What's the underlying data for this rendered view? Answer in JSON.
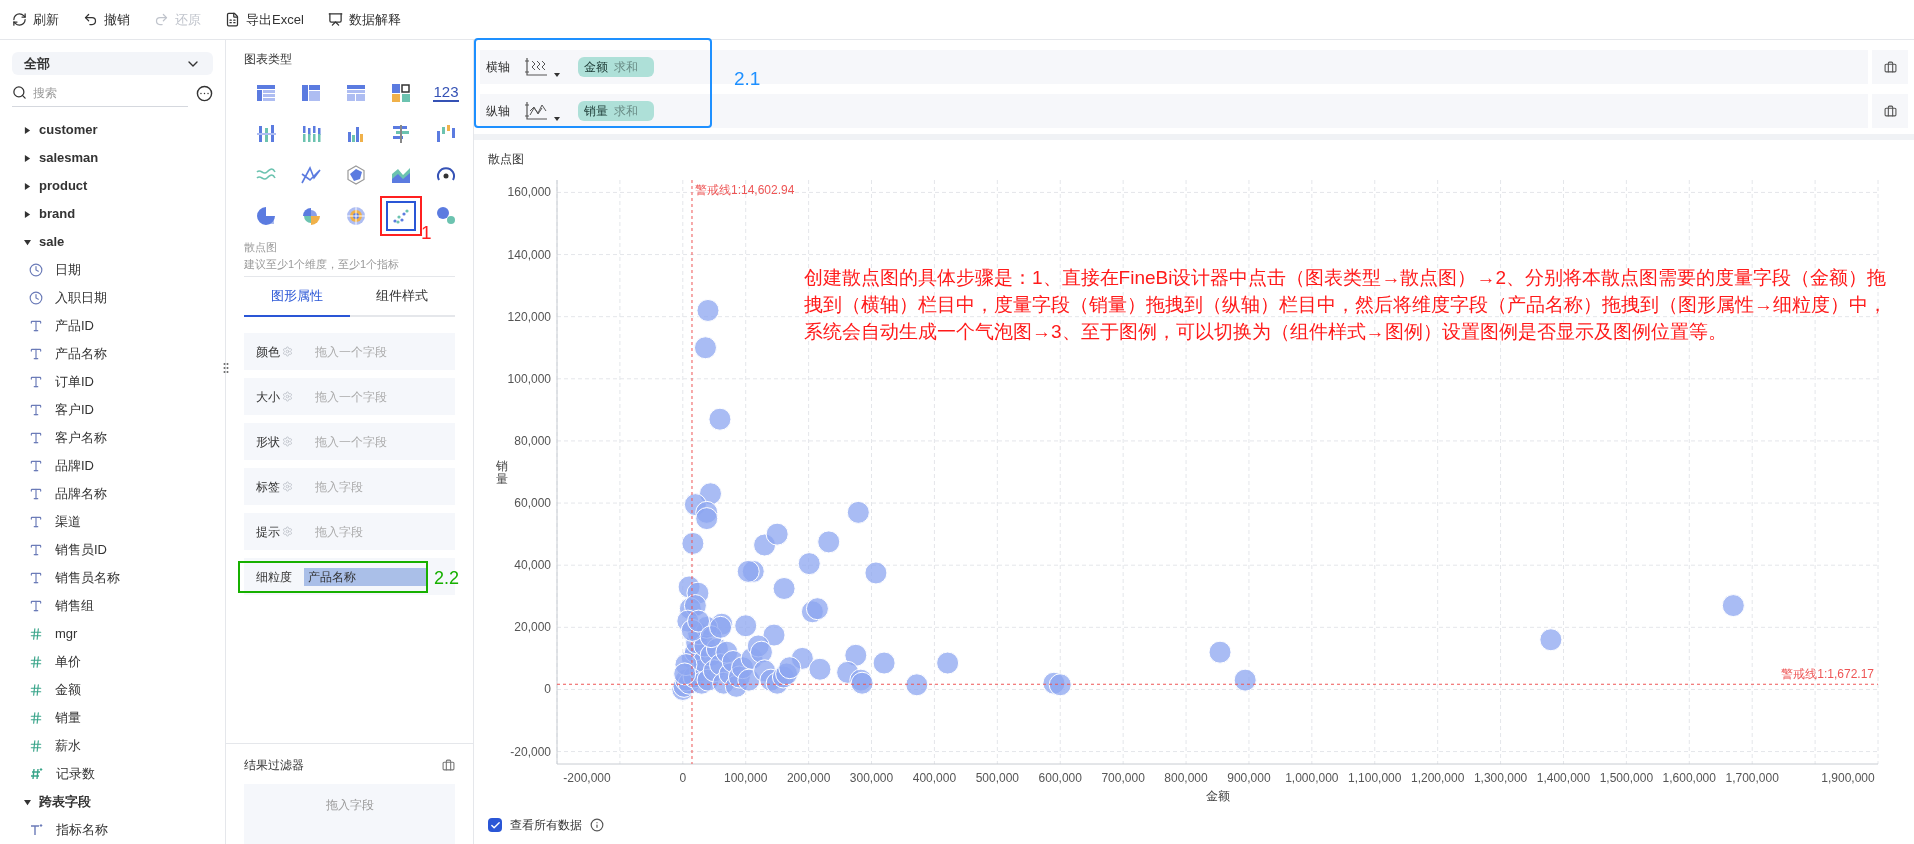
{
  "toolbar": [
    {
      "label": "刷新",
      "kind": "refresh",
      "disabled": false
    },
    {
      "label": "撤销",
      "kind": "undo",
      "disabled": false
    },
    {
      "label": "还原",
      "kind": "redo",
      "disabled": true
    },
    {
      "label": "导出Excel",
      "kind": "excel",
      "disabled": false
    },
    {
      "label": "数据解释",
      "kind": "explain",
      "disabled": false
    }
  ],
  "sidebar": {
    "dropdown": "全部",
    "search": {
      "placeholder": "搜索"
    },
    "fields": [
      {
        "label": "customer",
        "expanded": false
      },
      {
        "label": "salesman",
        "expanded": false
      },
      {
        "label": "product",
        "expanded": false
      },
      {
        "label": "brand",
        "expanded": false
      },
      {
        "label": "sale",
        "expanded": true,
        "children": [
          {
            "label": "日期",
            "kind": "date"
          },
          {
            "label": "入职日期",
            "kind": "date"
          },
          {
            "label": "产品ID",
            "kind": "text"
          },
          {
            "label": "产品名称",
            "kind": "text"
          },
          {
            "label": "订单ID",
            "kind": "text"
          },
          {
            "label": "客户ID",
            "kind": "text"
          },
          {
            "label": "客户名称",
            "kind": "text"
          },
          {
            "label": "品牌ID",
            "kind": "text"
          },
          {
            "label": "品牌名称",
            "kind": "text"
          },
          {
            "label": "渠道",
            "kind": "text"
          },
          {
            "label": "销售员ID",
            "kind": "text"
          },
          {
            "label": "销售员名称",
            "kind": "text"
          },
          {
            "label": "销售组",
            "kind": "text"
          },
          {
            "label": "mgr",
            "kind": "number"
          },
          {
            "label": "单价",
            "kind": "number"
          },
          {
            "label": "金额",
            "kind": "number"
          },
          {
            "label": "销量",
            "kind": "number"
          },
          {
            "label": "薪水",
            "kind": "number"
          },
          {
            "label": "记录数",
            "kind": "calc-number"
          }
        ]
      },
      {
        "label": "跨表字段",
        "expanded": true,
        "children": [
          {
            "label": "指标名称",
            "kind": "calc-text"
          }
        ]
      }
    ]
  },
  "chart_types_panel": {
    "title": "图表类型",
    "marker_label": "1",
    "types": [
      {
        "kind": "table",
        "selected": false
      },
      {
        "kind": "cross-table",
        "selected": false
      },
      {
        "kind": "detail-table",
        "selected": false
      },
      {
        "kind": "blocks",
        "selected": false
      },
      {
        "kind": "number",
        "label": "123",
        "selected": false
      },
      {
        "kind": "dot-bars",
        "selected": false
      },
      {
        "kind": "stacked-bars",
        "selected": false
      },
      {
        "kind": "bars",
        "selected": false
      },
      {
        "kind": "hbars",
        "selected": false
      },
      {
        "kind": "waterfall",
        "selected": false
      },
      {
        "kind": "waves",
        "selected": false
      },
      {
        "kind": "lines",
        "selected": false
      },
      {
        "kind": "radar",
        "selected": false
      },
      {
        "kind": "area",
        "selected": false
      },
      {
        "kind": "gauge",
        "selected": false
      },
      {
        "kind": "pie",
        "selected": false
      },
      {
        "kind": "rose",
        "selected": false
      },
      {
        "kind": "polar",
        "selected": false
      },
      {
        "kind": "scatter",
        "selected": true
      },
      {
        "kind": "bubble",
        "selected": false
      }
    ],
    "hint_title": "散点图",
    "hint": "建议至少1个维度，至少1个指标"
  },
  "property_tabs": [
    {
      "label": "图形属性",
      "selected": true
    },
    {
      "label": "组件样式",
      "selected": false
    }
  ],
  "properties": [
    {
      "label": "颜色",
      "kind": "drop",
      "placeholder": "拖入一个字段"
    },
    {
      "label": "大小",
      "kind": "drop",
      "placeholder": "拖入一个字段"
    },
    {
      "label": "形状",
      "kind": "drop",
      "placeholder": "拖入一个字段"
    },
    {
      "label": "标签",
      "kind": "drop",
      "placeholder": "拖入字段"
    },
    {
      "label": "提示",
      "kind": "drop",
      "placeholder": "拖入字段"
    },
    {
      "label": "细粒度",
      "kind": "granularity",
      "value": "产品名称",
      "marker_label": "2.2"
    }
  ],
  "result_filter": {
    "title": "结果过滤器",
    "placeholder": "拖入字段"
  },
  "axes": {
    "marker_label": "2.1",
    "rows": [
      {
        "label": "横轴",
        "kind": "x",
        "field": "金额",
        "aggregation": "求和"
      },
      {
        "label": "纵轴",
        "kind": "y",
        "field": "销量",
        "aggregation": "求和"
      }
    ]
  },
  "chart": {
    "title": "散点图",
    "note": "创建散点图的具体步骤是：1、直接在FineBi设计器中点击（图表类型→散点图）→2、分别将本散点图需要的度量字段（金额）拖拽到（横轴）栏目中，度量字段（销量）拖拽到（纵轴）栏目中，然后将维度字段（产品名称）拖拽到（图形属性→细粒度）中，系统会自动生成一个气泡图→3、至于图例，可以切换为（组件样式→图例）设置图例是否显示及图例位置等。",
    "show_all": {
      "label": "查看所有数据",
      "checked": true
    },
    "chart_data": {
      "type": "scatter",
      "grid": true,
      "xlabel": "金额",
      "ylabel": "销量",
      "xlim": [
        -200000,
        1900000
      ],
      "ylim": [
        -24000,
        164000
      ],
      "xticks": [
        {
          "value": -200000,
          "label": "-200,000"
        },
        {
          "value": 0,
          "label": "0"
        },
        {
          "value": 100000,
          "label": "100,000"
        },
        {
          "value": 200000,
          "label": "200,000"
        },
        {
          "value": 300000,
          "label": "300,000"
        },
        {
          "value": 400000,
          "label": "400,000"
        },
        {
          "value": 500000,
          "label": "500,000"
        },
        {
          "value": 600000,
          "label": "600,000"
        },
        {
          "value": 700000,
          "label": "700,000"
        },
        {
          "value": 800000,
          "label": "800,000"
        },
        {
          "value": 900000,
          "label": "900,000"
        },
        {
          "value": 1000000,
          "label": "1,000,000"
        },
        {
          "value": 1100000,
          "label": "1,100,000"
        },
        {
          "value": 1200000,
          "label": "1,200,000"
        },
        {
          "value": 1300000,
          "label": "1,300,000"
        },
        {
          "value": 1400000,
          "label": "1,400,000"
        },
        {
          "value": 1500000,
          "label": "1,500,000"
        },
        {
          "value": 1600000,
          "label": "1,600,000"
        },
        {
          "value": 1700000,
          "label": "1,700,000"
        },
        {
          "value": 1900000,
          "label": "1,900,000"
        }
      ],
      "yticks": [
        {
          "value": -20000,
          "label": "-20,000"
        },
        {
          "value": 0,
          "label": "0"
        },
        {
          "value": 20000,
          "label": "20,000"
        },
        {
          "value": 40000,
          "label": "40,000"
        },
        {
          "value": 60000,
          "label": "60,000"
        },
        {
          "value": 80000,
          "label": "80,000"
        },
        {
          "value": 100000,
          "label": "100,000"
        },
        {
          "value": 120000,
          "label": "120,000"
        },
        {
          "value": 140000,
          "label": "140,000"
        },
        {
          "value": 160000,
          "label": "160,000"
        }
      ],
      "x": [
        40000,
        36000,
        59000,
        44000,
        20000,
        38000,
        38000,
        16000,
        112000,
        104000,
        130000,
        150000,
        161000,
        201000,
        232000,
        279000,
        307000,
        206000,
        214000,
        10000,
        24000,
        12000,
        20000,
        100000,
        62000,
        145000,
        190000,
        218000,
        275000,
        262000,
        320000,
        283000,
        285000,
        421000,
        372000,
        590000,
        600000,
        854000,
        894000,
        1380000,
        1670000,
        0,
        2000,
        5000,
        10000,
        15000,
        18000,
        20000,
        22000,
        25000,
        28000,
        30000,
        33000,
        35000,
        38000,
        40000,
        45000,
        50000,
        55000,
        60000,
        65000,
        70000,
        75000,
        80000,
        85000,
        90000,
        95000,
        105000,
        110000,
        120000,
        125000,
        130000,
        140000,
        150000,
        160000,
        165000,
        170000,
        5000,
        8000,
        15000,
        25000,
        45000,
        60000,
        3000
      ],
      "series": [
        {
          "color": "#8ca6f0",
          "values": [
            122000,
            110000,
            87000,
            63000,
            59500,
            57000,
            55000,
            47000,
            38000,
            38000,
            46500,
            50000,
            32500,
            40500,
            47500,
            57000,
            37500,
            25000,
            26000,
            33000,
            31000,
            26000,
            27000,
            20500,
            21000,
            17500,
            10000,
            6500,
            11000,
            5500,
            8500,
            3000,
            2000,
            8500,
            1500,
            2000,
            1500,
            12000,
            3000,
            16000,
            27000,
            0,
            1000,
            3000,
            2000,
            10000,
            4000,
            12000,
            15000,
            18000,
            6000,
            2000,
            9000,
            14000,
            20000,
            3000,
            11000,
            6000,
            13000,
            8000,
            2000,
            12000,
            5000,
            9000,
            1000,
            4000,
            7000,
            3000,
            10000,
            14000,
            12000,
            6000,
            3000,
            2000,
            4000,
            5000,
            7000,
            8000,
            22000,
            19000,
            22000,
            17000,
            20000,
            5000
          ]
        }
      ],
      "ref_lines": [
        {
          "axis": "x",
          "value": 14602.94,
          "label": "警戒线1:14,602.94"
        },
        {
          "axis": "y",
          "value": 1672.17,
          "label": "警戒线1:1,672.17"
        }
      ]
    }
  }
}
